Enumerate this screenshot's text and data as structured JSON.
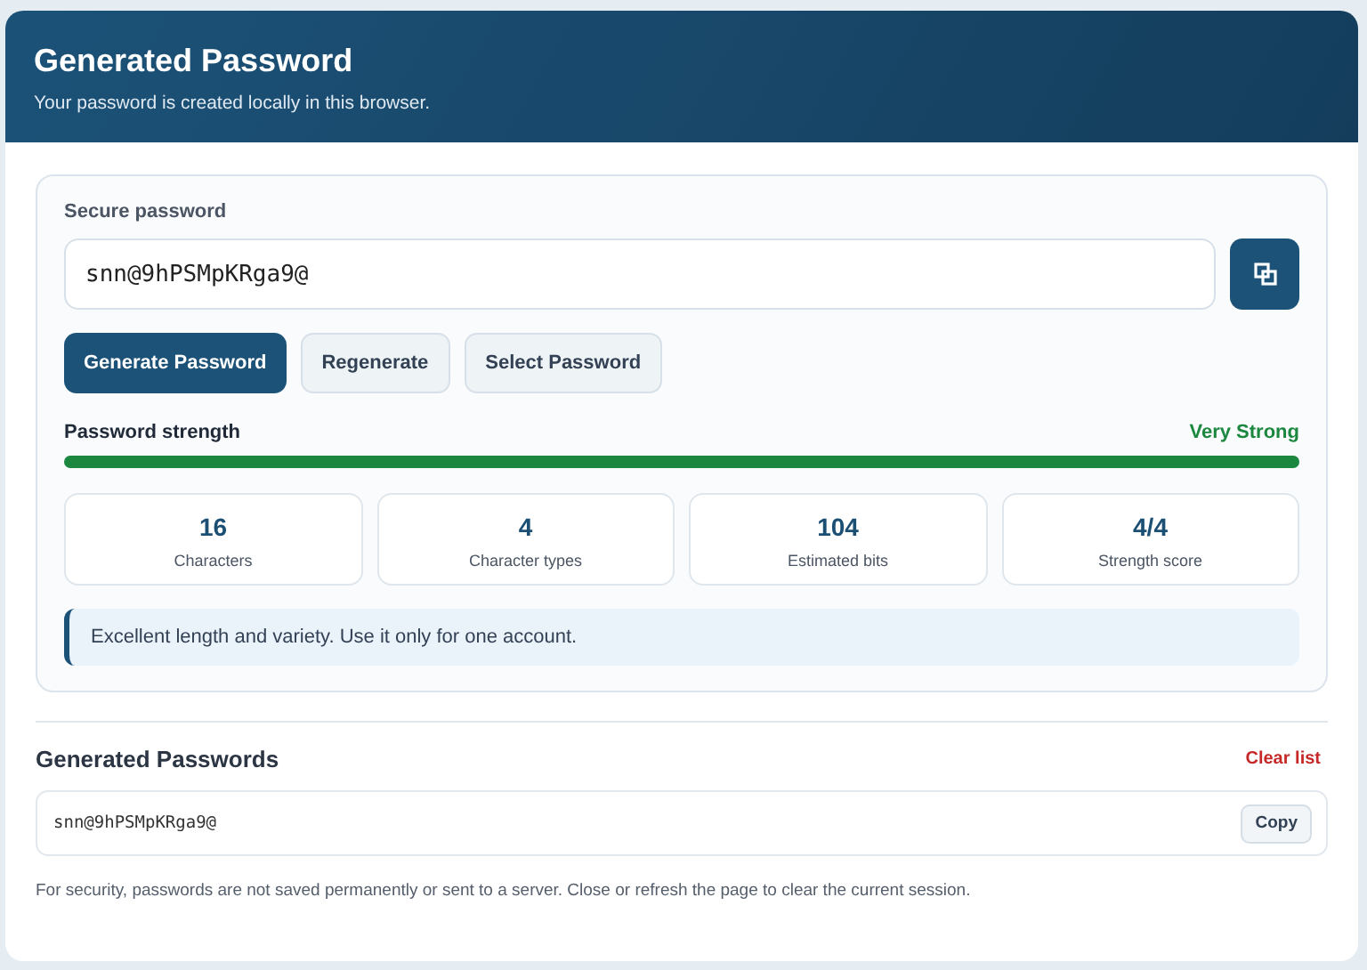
{
  "header": {
    "title": "Generated Password",
    "subtitle": "Your password is created locally in this browser."
  },
  "generator": {
    "field_label": "Secure password",
    "password": "snn@9hPSMpKRga9@",
    "buttons": [
      {
        "label": "Generate Password",
        "kind": "primary"
      },
      {
        "label": "Regenerate",
        "kind": "secondary"
      },
      {
        "label": "Select Password",
        "kind": "secondary"
      }
    ],
    "strength": {
      "label": "Password strength",
      "rating": "Very Strong",
      "level": 1
    },
    "stats": [
      {
        "value": "16",
        "label": "Characters"
      },
      {
        "value": "4",
        "label": "Character types"
      },
      {
        "value": "104",
        "label": "Estimated bits"
      },
      {
        "value": "4/4",
        "label": "Strength score"
      }
    ],
    "note": "Excellent length and variety. Use it only for one account."
  },
  "history": {
    "title": "Generated Passwords",
    "clear": "Clear list",
    "items": [
      {
        "password": "snn@9hPSMpKRga9@",
        "action": "Copy"
      }
    ]
  },
  "footer": "For security, passwords are not saved permanently or sent to a server. Close or refresh the page to clear the current session."
}
